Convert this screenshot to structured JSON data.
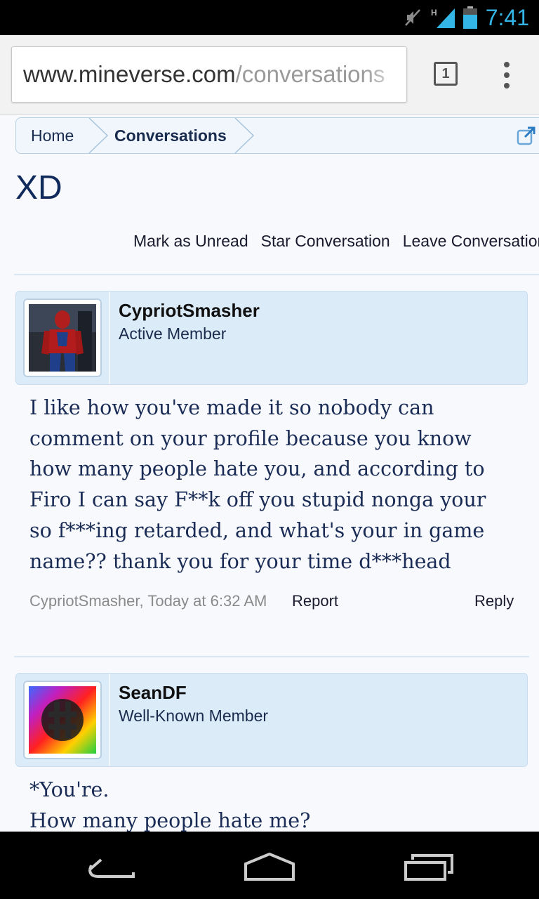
{
  "status_bar": {
    "time": "7:41",
    "network_type": "H",
    "icons": [
      "mute-icon",
      "signal-icon",
      "battery-icon"
    ],
    "accent_color": "#33b5e5"
  },
  "browser": {
    "url_host": "www.mineverse.com",
    "url_path": "/conversations",
    "tab_count": "1",
    "menu_icon": "overflow-menu-icon"
  },
  "breadcrumb": {
    "items": [
      "Home",
      "Conversations"
    ],
    "popout_icon": "popout-icon"
  },
  "conversation": {
    "title": "XD",
    "actions": [
      "Mark as Unread",
      "Star Conversation",
      "Leave Conversation"
    ]
  },
  "messages": [
    {
      "username": "CypriotSmasher",
      "user_title": "Active Member",
      "avatar": "spiderman-avatar",
      "lines": [
        "I like how you've made it so nobody can",
        "comment on your profile because you know",
        "how many people hate you, and according to",
        "Firo I can say F**k off you stupid nonga your",
        "so f***ing retarded, and what's your in game",
        "name?? thank you for your time d***head"
      ],
      "meta": "CypriotSmasher, Today at 6:32 AM",
      "report": "Report",
      "reply": "Reply"
    },
    {
      "username": "SeanDF",
      "user_title": "Well-Known Member",
      "avatar": "rainbow-logo-avatar",
      "lines": [
        "*You're.",
        "How many people hate me?"
      ]
    }
  ],
  "nav_bar": {
    "buttons": [
      "back-icon",
      "home-icon",
      "recent-apps-icon"
    ]
  }
}
